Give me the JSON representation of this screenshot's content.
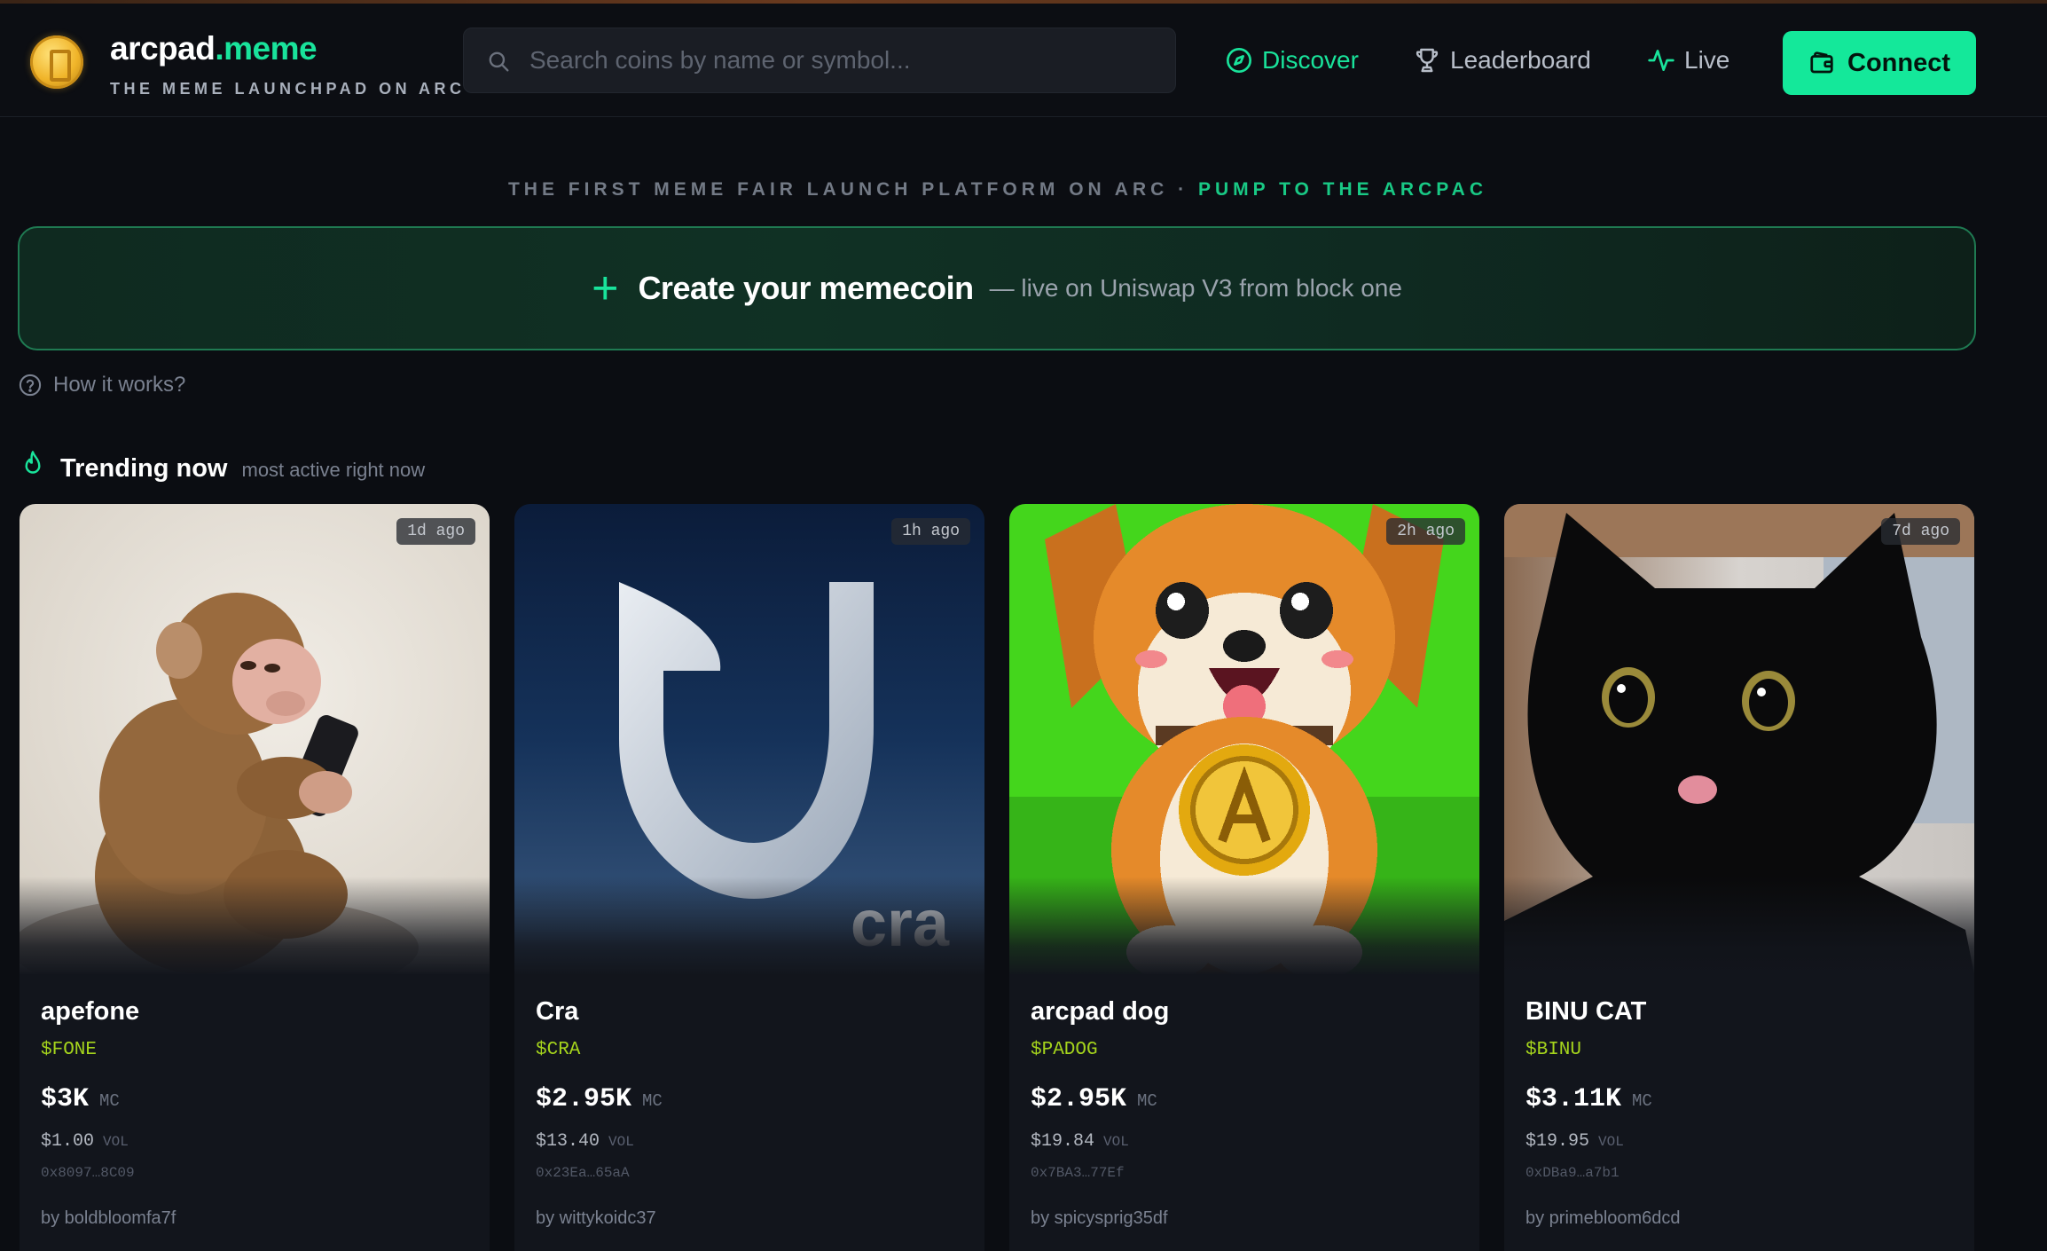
{
  "header": {
    "brand_main": "arcpad",
    "brand_accent": ".meme",
    "tagline": "THE MEME LAUNCHPAD ON ARC",
    "search_placeholder": "Search coins by name or symbol...",
    "nav": {
      "discover": "Discover",
      "leaderboard": "Leaderboard",
      "live": "Live"
    },
    "connect_label": "Connect"
  },
  "hero": {
    "subtag_main": "THE FIRST MEME FAIR LAUNCH PLATFORM ON ARC · ",
    "subtag_accent": "PUMP TO THE ARCPAC",
    "create_plus": "+",
    "create_title": "Create your memecoin",
    "create_sub": "— live on Uniswap V3 from block one",
    "how_it_works": "How it works?"
  },
  "trending": {
    "title": "Trending now",
    "subtitle": "most active right now"
  },
  "cards": [
    {
      "name": "apefone",
      "symbol": "$FONE",
      "mc": "$3K",
      "mc_label": "MC",
      "vol": "$1.00",
      "vol_label": "VOL",
      "address": "0x8097…8C09",
      "creator": "by boldbloomfa7f",
      "age": "1d ago",
      "art": "monkey"
    },
    {
      "name": "Cra",
      "symbol": "$CRA",
      "mc": "$2.95K",
      "mc_label": "MC",
      "vol": "$13.40",
      "vol_label": "VOL",
      "address": "0x23Ea…65aA",
      "creator": "by wittykoidc37",
      "age": "1h ago",
      "art": "cra-logo",
      "art_text": "cra"
    },
    {
      "name": "arcpad dog",
      "symbol": "$PADOG",
      "mc": "$2.95K",
      "mc_label": "MC",
      "vol": "$19.84",
      "vol_label": "VOL",
      "address": "0x7BA3…77Ef",
      "creator": "by spicysprig35df",
      "age": "2h ago",
      "art": "pixel-dog"
    },
    {
      "name": "BINU CAT",
      "symbol": "$BINU",
      "mc": "$3.11K",
      "mc_label": "MC",
      "vol": "$19.95",
      "vol_label": "VOL",
      "address": "0xDBa9…a7b1",
      "creator": "by primebloom6dcd",
      "age": "7d ago",
      "art": "black-cat"
    }
  ],
  "colors": {
    "accent": "#19e39b",
    "background": "#0b0d12",
    "card": "#12151c",
    "symbol": "#a5d41c"
  }
}
